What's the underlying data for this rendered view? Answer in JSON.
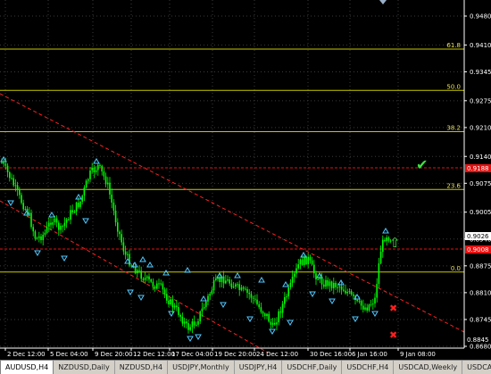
{
  "symbol": "AUDUSD, H4",
  "colors": {
    "background": "#000000",
    "candle": "#00ff00",
    "grid": "#3a3a3a",
    "fib": "#c8c800",
    "trendline": "#ff2020",
    "arrow": "#50c8ff",
    "price_label_red": "#e81010",
    "check": "#40e040",
    "cross": "#ff2020"
  },
  "price_axis": {
    "ticks": [
      "0.9480",
      "0.9410",
      "0.9345",
      "0.9275",
      "0.9210",
      "0.9140",
      "0.9075",
      "0.9005",
      "0.8940",
      "0.8875",
      "0.8810",
      "0.8745",
      "0.8680"
    ],
    "tick_values": [
      0.948,
      0.941,
      0.9345,
      0.9275,
      0.921,
      0.914,
      0.9075,
      0.9005,
      0.894,
      0.8875,
      0.881,
      0.8745,
      0.868
    ],
    "labels": {
      "red_1": "0.9188",
      "current": "0.9026",
      "red_2": "0.9008",
      "bottom": "0.8845"
    }
  },
  "time_axis": {
    "labels": [
      "2 Dec 12:00",
      "5 Dec 04:00",
      "9 Dec 20:00",
      "12 Dec 12:00",
      "17 Dec 04:00",
      "19 Dec 20:00",
      "24 Dec 12:00",
      "30 Dec 16:00",
      "6 Jan 16:00",
      "9 Jan 08:00"
    ]
  },
  "fibonacci": [
    {
      "label": "61.8",
      "price": 0.94
    },
    {
      "label": "50.0",
      "price": 0.93
    },
    {
      "label": "38.2",
      "price": 0.92
    },
    {
      "label": "23.6",
      "price": 0.906
    },
    {
      "label": "0.0",
      "price": 0.886
    }
  ],
  "markers": {
    "check": "✔",
    "cross": "✖",
    "up_arrow": "⇧"
  },
  "tabs": [
    {
      "label": "AUDUSD,H4",
      "active": true
    },
    {
      "label": "NZDUSD,Daily",
      "active": false
    },
    {
      "label": "NZDUSD,H4",
      "active": false
    },
    {
      "label": "USDJPY,Monthly",
      "active": false
    },
    {
      "label": "USDJPY,H4",
      "active": false
    },
    {
      "label": "USDCHF,Daily",
      "active": false
    },
    {
      "label": "USDCHF,H4",
      "active": false
    },
    {
      "label": "USDCAD,Weekly",
      "active": false
    },
    {
      "label": "USDCAD,H4",
      "active": false
    }
  ],
  "tab_nav": {
    "prev": "◄",
    "next": "►"
  }
}
